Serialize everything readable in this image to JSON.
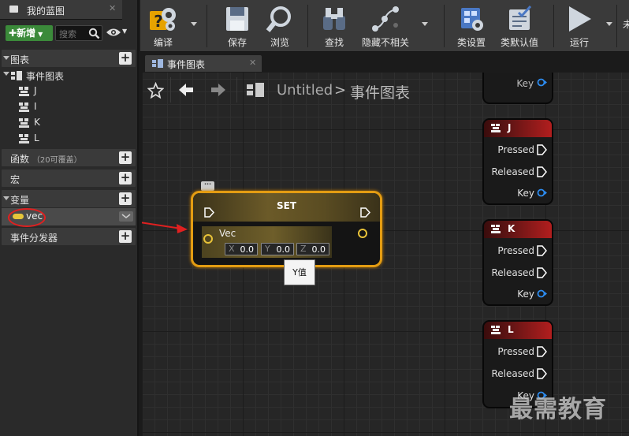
{
  "blueprint_panel": {
    "tab_title": "我的蓝图",
    "add_button": "新增",
    "search_placeholder": "搜索",
    "sections": {
      "graphs": "图表",
      "event_graph": "事件图表",
      "functions": "函数",
      "functions_sub": "（20可覆盖）",
      "macros": "宏",
      "variables": "变量",
      "dispatchers": "事件分发器"
    },
    "events": [
      "J",
      "I",
      "K",
      "L"
    ],
    "variable_name": "vec",
    "variable_color": "#e6c63a"
  },
  "toolbar": {
    "items": [
      "编译",
      "保存",
      "浏览",
      "查找",
      "隐藏不相关",
      "类设置",
      "类默认值",
      "运行"
    ],
    "overflow_label": "未"
  },
  "graph_tab": {
    "title": "事件图表"
  },
  "breadcrumb": {
    "blueprint": "Untitled",
    "separator": ">",
    "graph": "事件图表"
  },
  "set_node": {
    "title": "SET",
    "pin_label": "Vec",
    "x_label": "X",
    "x_value": "0.0",
    "y_label": "Y",
    "y_value": "0.0",
    "z_label": "Z",
    "z_value": "0.0",
    "tooltip": "Y值",
    "accent": "#e39c12"
  },
  "key_nodes": [
    {
      "title": "J",
      "pressed": "Pressed",
      "released": "Released",
      "key": "Key"
    },
    {
      "title": "K",
      "pressed": "Pressed",
      "released": "Released",
      "key": "Key"
    },
    {
      "title": "L",
      "pressed": "Pressed",
      "released": "Released",
      "key": "Key"
    }
  ],
  "top_partial_key": "Key",
  "watermark": "最需教育"
}
